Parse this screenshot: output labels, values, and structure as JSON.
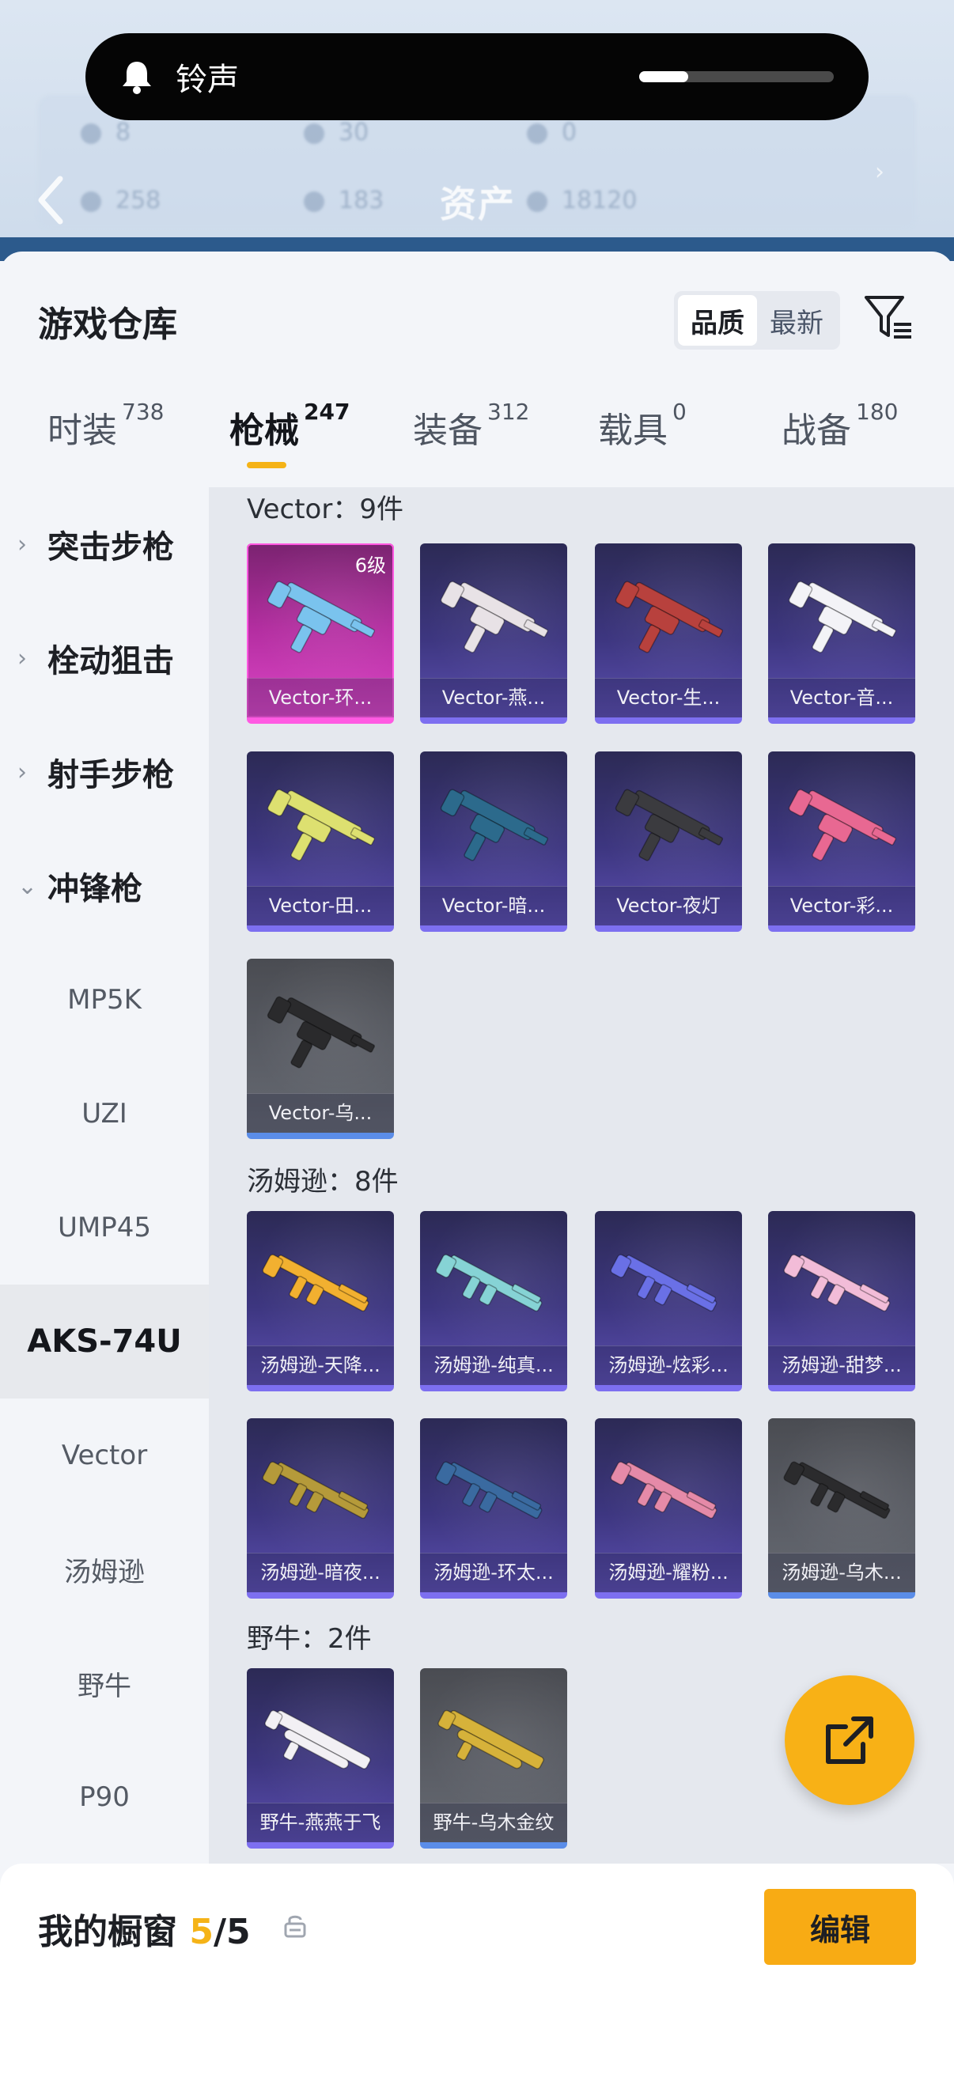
{
  "toast": {
    "label": "铃声",
    "volume": 0.25
  },
  "background_header": {
    "title": "资产",
    "stats_row1": [
      "8",
      "30",
      "0"
    ],
    "stats_row2": [
      "258",
      "183",
      "18120"
    ]
  },
  "sheet": {
    "title": "游戏仓库",
    "sort_options": [
      "品质",
      "最新"
    ],
    "sort_selected": "品质"
  },
  "tabs": [
    {
      "label": "时装",
      "count": "738"
    },
    {
      "label": "枪械",
      "count": "247",
      "active": true
    },
    {
      "label": "装备",
      "count": "312"
    },
    {
      "label": "载具",
      "count": "0"
    },
    {
      "label": "战备",
      "count": "180"
    }
  ],
  "sidebar": {
    "categories": [
      {
        "label": "突击步枪",
        "expanded": false
      },
      {
        "label": "栓动狙击",
        "expanded": false
      },
      {
        "label": "射手步枪",
        "expanded": false
      },
      {
        "label": "冲锋枪",
        "expanded": true
      }
    ],
    "sub_items": [
      "MP5K",
      "UZI",
      "UMP45",
      "AKS-74U",
      "Vector",
      "汤姆逊",
      "野牛",
      "P90"
    ],
    "active_sub": "AKS-74U"
  },
  "groups": [
    {
      "title": "Vector：9件",
      "items": [
        {
          "name": "Vector-环...",
          "rarity": "gold",
          "level": "6级",
          "color": "#7ac3ee"
        },
        {
          "name": "Vector-燕...",
          "rarity": "purple",
          "color": "#e8e2e6"
        },
        {
          "name": "Vector-生...",
          "rarity": "purple",
          "color": "#b8413d"
        },
        {
          "name": "Vector-音...",
          "rarity": "purple",
          "color": "#f3f3f7"
        },
        {
          "name": "Vector-田...",
          "rarity": "purple",
          "color": "#dde070"
        },
        {
          "name": "Vector-暗...",
          "rarity": "purple",
          "color": "#2c6a8c"
        },
        {
          "name": "Vector-夜灯",
          "rarity": "purple",
          "color": "#3b3b3f"
        },
        {
          "name": "Vector-彩...",
          "rarity": "purple",
          "color": "#e86892"
        },
        {
          "name": "Vector-乌...",
          "rarity": "gray",
          "color": "#2a2a2c"
        }
      ]
    },
    {
      "title": "汤姆逊：8件",
      "items": [
        {
          "name": "汤姆逊-天降...",
          "rarity": "purple",
          "color": "#f2b030"
        },
        {
          "name": "汤姆逊-纯真...",
          "rarity": "purple",
          "color": "#86d3d5"
        },
        {
          "name": "汤姆逊-炫彩...",
          "rarity": "purple",
          "color": "#6a70e6"
        },
        {
          "name": "汤姆逊-甜梦...",
          "rarity": "purple",
          "color": "#f2bcd8"
        },
        {
          "name": "汤姆逊-暗夜...",
          "rarity": "purple",
          "color": "#b59a3a"
        },
        {
          "name": "汤姆逊-环太...",
          "rarity": "purple",
          "color": "#3a6aa0"
        },
        {
          "name": "汤姆逊-耀粉...",
          "rarity": "purple",
          "color": "#e58aa8"
        },
        {
          "name": "汤姆逊-乌木...",
          "rarity": "gray",
          "color": "#2b2b2d"
        }
      ]
    },
    {
      "title": "野牛：2件",
      "items": [
        {
          "name": "野牛-燕燕于飞",
          "rarity": "purple",
          "color": "#f2f0f4"
        },
        {
          "name": "野牛-乌木金纹",
          "rarity": "gray",
          "color": "#d6b23a"
        }
      ]
    }
  ],
  "bottom": {
    "label": "我的橱窗",
    "current": "5",
    "total": "/5",
    "edit_label": "编辑"
  },
  "colors": {
    "accent": "#f5b317",
    "purple_card": "#3d3680",
    "gold_card": "#b42ea1",
    "gray_card": "#5b5e66"
  }
}
